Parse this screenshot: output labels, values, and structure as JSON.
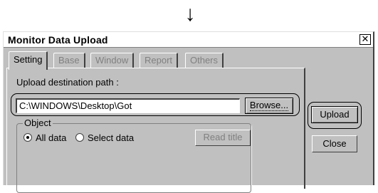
{
  "arrow": "↓",
  "window": {
    "title": "Monitor Data Upload",
    "close_glyph": "✕"
  },
  "tabs": [
    {
      "label": "Setting",
      "active": true
    },
    {
      "label": "Base",
      "active": false
    },
    {
      "label": "Window",
      "active": false
    },
    {
      "label": "Report",
      "active": false
    },
    {
      "label": "Others",
      "active": false
    }
  ],
  "upload": {
    "path_label": "Upload destination path :",
    "path_value": "C:\\WINDOWS\\Desktop\\Got",
    "browse_label": "Browse..."
  },
  "object_group": {
    "legend": "Object",
    "options": [
      {
        "label": "All data",
        "selected": true
      },
      {
        "label": "Select data",
        "selected": false
      }
    ],
    "read_title_label": "Read title"
  },
  "buttons": {
    "upload_label": "Upload",
    "close_label": "Close"
  },
  "colors": {
    "dialog_bg": "#c0c0c0",
    "titlebar_bg": "#ffffff",
    "disabled_text": "#808080"
  }
}
